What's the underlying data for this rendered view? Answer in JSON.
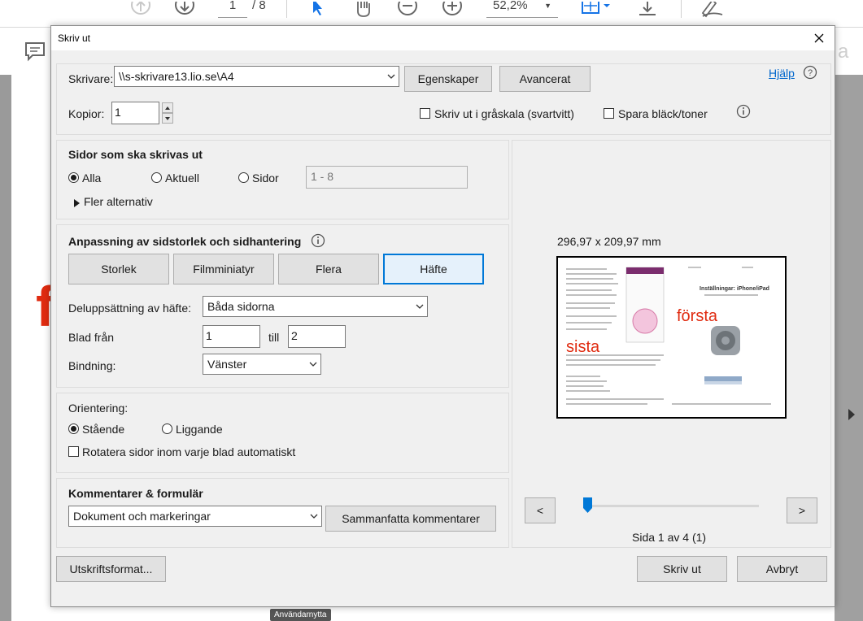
{
  "app_toolbar": {
    "page_current": "1",
    "page_total": "/ 8",
    "zoom": "52,2%",
    "tooltip": "Användarnytta"
  },
  "dialog": {
    "title": "Skriv ut",
    "printer": {
      "label": "Skrivare:",
      "value": "\\\\s-skrivare13.lio.se\\A4",
      "properties_button": "Egenskaper",
      "advanced_button": "Avancerat",
      "help_link": "Hjälp"
    },
    "copies": {
      "label": "Kopior:",
      "value": "1",
      "grayscale_label": "Skriv ut i gråskala (svartvitt)",
      "save_ink_label": "Spara bläck/toner"
    },
    "pages": {
      "heading": "Sidor som ska skrivas ut",
      "all": "Alla",
      "current": "Aktuell",
      "pages": "Sidor",
      "range_value": "1 - 8",
      "more_options": "Fler alternativ",
      "selected": "Alla"
    },
    "sizing": {
      "heading": "Anpassning av sidstorlek och sidhantering",
      "size_button": "Storlek",
      "poster_button": "Filmminiatyr",
      "multiple_button": "Flera",
      "booklet_button": "Häfte",
      "active": "Häfte",
      "subset_label": "Deluppsättning av häfte:",
      "subset_value": "Båda sidorna",
      "sheets_from_label": "Blad från",
      "sheets_from_value": "1",
      "to_label": "till",
      "to_value": "2",
      "binding_label": "Bindning:",
      "binding_value": "Vänster"
    },
    "orientation": {
      "heading": "Orientering:",
      "portrait": "Stående",
      "landscape": "Liggande",
      "auto_rotate": "Rotatera sidor inom varje blad automatiskt",
      "selected": "Stående"
    },
    "comments": {
      "heading": "Kommentarer & formulär",
      "value": "Dokument och markeringar",
      "summarize_button": "Sammanfatta kommentarer"
    },
    "preview": {
      "size_text": "296,97 x 209,97 mm",
      "page_indicator": "Sida 1 av 4 (1)",
      "prev_button": "<",
      "next_button": ">",
      "position_fraction": 0.0,
      "thumb_text_right": "första",
      "thumb_text_left": "sista",
      "thumb_heading": "Inställningar: iPhone/iPad"
    },
    "footer": {
      "page_setup_button": "Utskriftsformat...",
      "print_button": "Skriv ut",
      "cancel_button": "Avbryt"
    }
  },
  "colors": {
    "accent": "#0078d7",
    "link": "#0066cc",
    "annotation_red": "#e02b10"
  }
}
